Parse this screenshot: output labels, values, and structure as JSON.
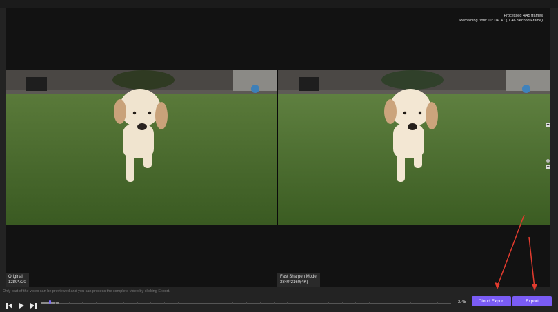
{
  "status": {
    "processed": "Processed 4/45 frames",
    "remaining": "Remaining time: 00: 04: 47 ( 7.46 Second/Frame)"
  },
  "panes": {
    "left": {
      "name": "Original",
      "resolution": "1280*720"
    },
    "right": {
      "name": "Fast Sharpen Model",
      "resolution": "3840*2160(4K)"
    }
  },
  "notice": "Only part of the video can be previewed and you can process the complete video by clicking Export.",
  "playback": {
    "frame_counter": "2/45",
    "progress": 0.0444
  },
  "buttons": {
    "cloud_export": "Cloud Export",
    "export": "Export"
  },
  "zoom": {
    "plus": "+",
    "minus": "−"
  },
  "icons": [
    "previous-frame-icon",
    "play-icon",
    "next-frame-icon",
    "zoom-in-icon",
    "zoom-out-icon"
  ],
  "colors": {
    "accent": "#7a5cf5",
    "annotation_arrow": "#e23b2e",
    "background": "#121212"
  }
}
